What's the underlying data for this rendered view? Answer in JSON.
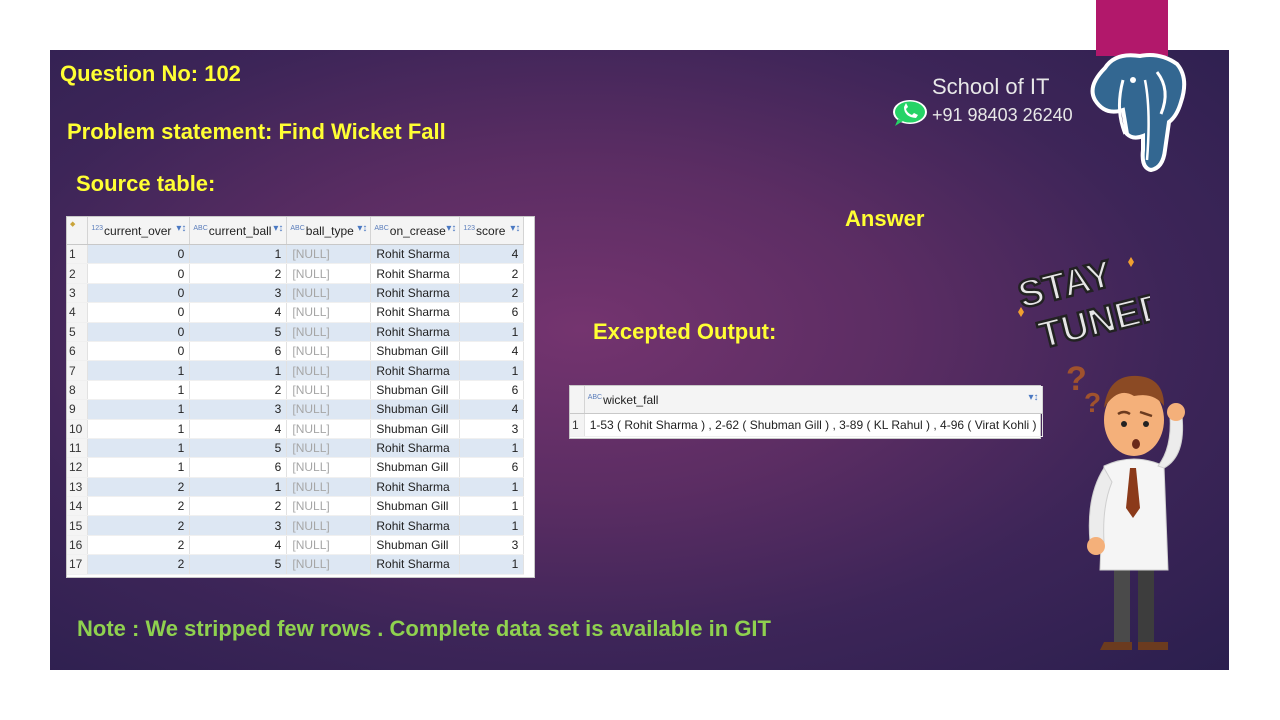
{
  "question_no": "Question No: 102",
  "problem_statement": "Problem statement: Find Wicket Fall",
  "source_label": "Source table:",
  "answer_label": "Answer",
  "expected_label": "Excepted Output:",
  "note": "Note : We stripped few rows . Complete data set is available in GIT",
  "school_name": "School of IT",
  "phone": "+91 98403 26240",
  "sticker_text": [
    "STAY",
    "TUNED"
  ],
  "source_table": {
    "columns": [
      {
        "type": "123",
        "name": "current_over"
      },
      {
        "type": "ABC",
        "name": "current_ball"
      },
      {
        "type": "ABC",
        "name": "ball_type"
      },
      {
        "type": "ABC",
        "name": "on_crease"
      },
      {
        "type": "123",
        "name": "score"
      }
    ],
    "rows": [
      {
        "n": "1",
        "over": "0",
        "ball": "1",
        "type": "[NULL]",
        "crease": "Rohit Sharma",
        "score": "4"
      },
      {
        "n": "2",
        "over": "0",
        "ball": "2",
        "type": "[NULL]",
        "crease": "Rohit Sharma",
        "score": "2"
      },
      {
        "n": "3",
        "over": "0",
        "ball": "3",
        "type": "[NULL]",
        "crease": "Rohit Sharma",
        "score": "2"
      },
      {
        "n": "4",
        "over": "0",
        "ball": "4",
        "type": "[NULL]",
        "crease": "Rohit Sharma",
        "score": "6"
      },
      {
        "n": "5",
        "over": "0",
        "ball": "5",
        "type": "[NULL]",
        "crease": "Rohit Sharma",
        "score": "1"
      },
      {
        "n": "6",
        "over": "0",
        "ball": "6",
        "type": "[NULL]",
        "crease": "Shubman Gill",
        "score": "4"
      },
      {
        "n": "7",
        "over": "1",
        "ball": "1",
        "type": "[NULL]",
        "crease": "Rohit Sharma",
        "score": "1"
      },
      {
        "n": "8",
        "over": "1",
        "ball": "2",
        "type": "[NULL]",
        "crease": "Shubman Gill",
        "score": "6"
      },
      {
        "n": "9",
        "over": "1",
        "ball": "3",
        "type": "[NULL]",
        "crease": "Shubman Gill",
        "score": "4"
      },
      {
        "n": "10",
        "over": "1",
        "ball": "4",
        "type": "[NULL]",
        "crease": "Shubman Gill",
        "score": "3"
      },
      {
        "n": "11",
        "over": "1",
        "ball": "5",
        "type": "[NULL]",
        "crease": "Rohit Sharma",
        "score": "1"
      },
      {
        "n": "12",
        "over": "1",
        "ball": "6",
        "type": "[NULL]",
        "crease": "Shubman Gill",
        "score": "6"
      },
      {
        "n": "13",
        "over": "2",
        "ball": "1",
        "type": "[NULL]",
        "crease": "Rohit Sharma",
        "score": "1"
      },
      {
        "n": "14",
        "over": "2",
        "ball": "2",
        "type": "[NULL]",
        "crease": "Shubman Gill",
        "score": "1"
      },
      {
        "n": "15",
        "over": "2",
        "ball": "3",
        "type": "[NULL]",
        "crease": "Rohit Sharma",
        "score": "1"
      },
      {
        "n": "16",
        "over": "2",
        "ball": "4",
        "type": "[NULL]",
        "crease": "Shubman Gill",
        "score": "3"
      },
      {
        "n": "17",
        "over": "2",
        "ball": "5",
        "type": "[NULL]",
        "crease": "Rohit Sharma",
        "score": "1"
      }
    ]
  },
  "output_table": {
    "column": {
      "type": "ABC",
      "name": "wicket_fall"
    },
    "rows": [
      {
        "n": "1",
        "value": "1-53 ( Rohit Sharma ) , 2-62 ( Shubman Gill ) , 3-89 ( KL Rahul ) , 4-96 ( Virat Kohli )"
      }
    ]
  },
  "colors": {
    "heading_yellow": "#ffff33",
    "note_green": "#8fd14f",
    "accent_pink": "#b2186b",
    "row_stripe": "#dde7f3"
  },
  "icons": [
    "whatsapp-icon",
    "postgresql-elephant-logo",
    "stay-tuned-sticker",
    "confused-man-illustration",
    "question-marks-icon"
  ]
}
